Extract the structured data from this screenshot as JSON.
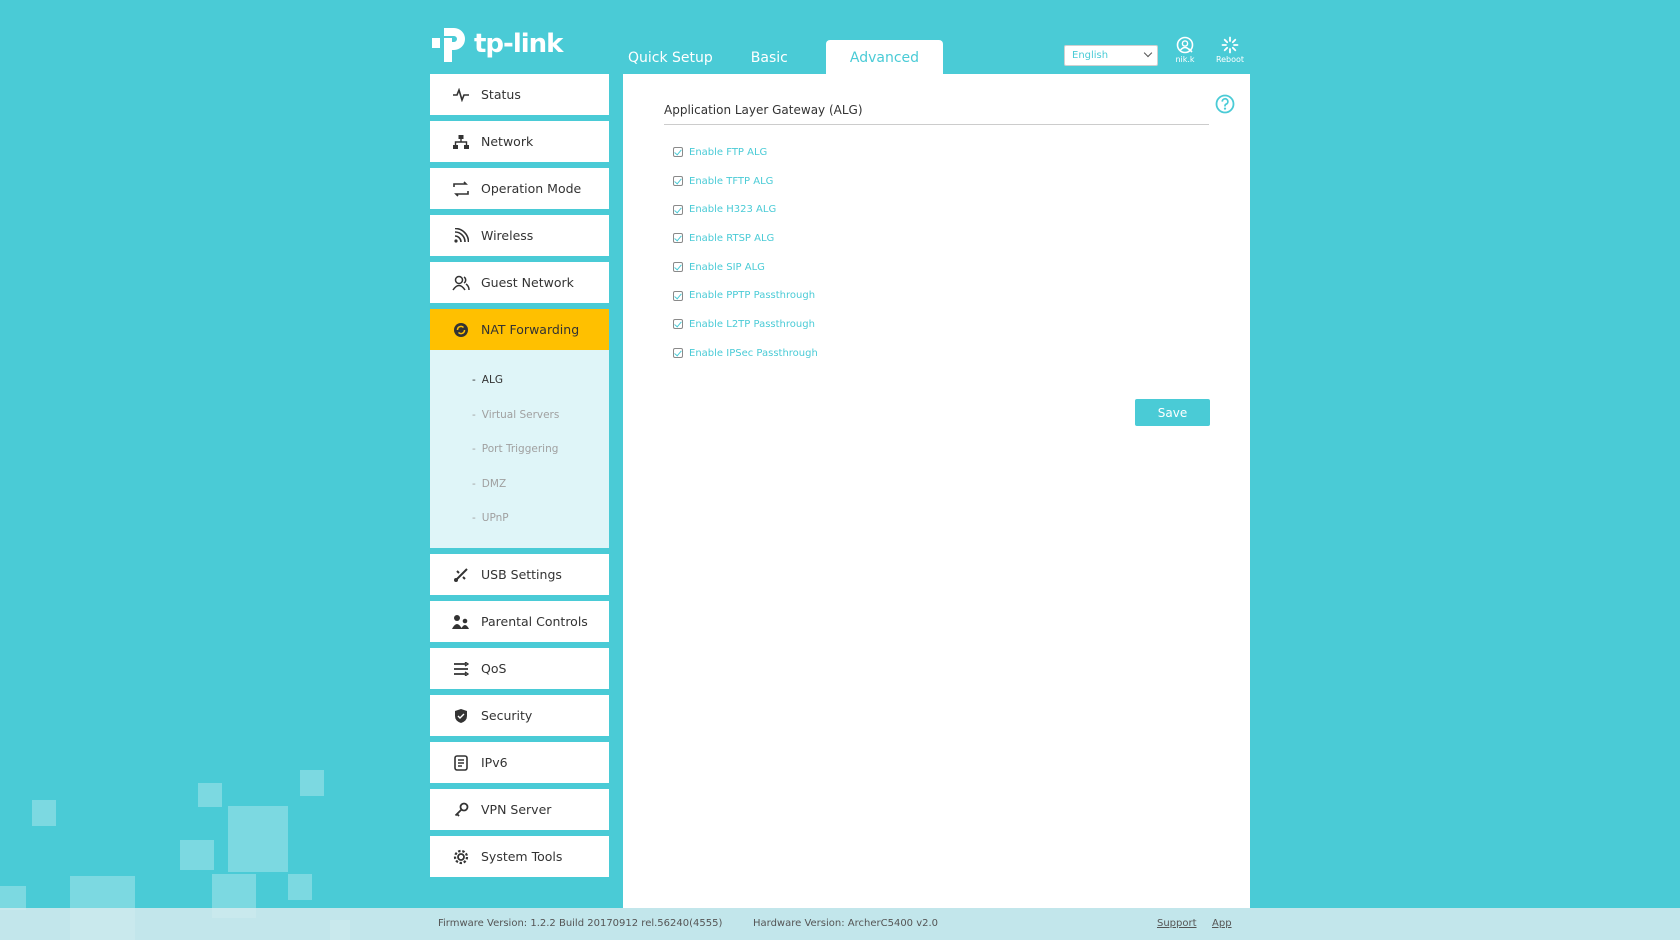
{
  "brand": {
    "logo_text": "tp-link"
  },
  "header": {
    "tabs": [
      {
        "label": "Quick Setup"
      },
      {
        "label": "Basic"
      },
      {
        "label": "Advanced",
        "active": true
      }
    ],
    "language": "English",
    "user_label": "nik.k",
    "reboot_label": "Reboot"
  },
  "sidebar": {
    "items": [
      {
        "label": "Status",
        "icon": "pulse-icon"
      },
      {
        "label": "Network",
        "icon": "network-icon"
      },
      {
        "label": "Operation Mode",
        "icon": "operation-mode-icon"
      },
      {
        "label": "Wireless",
        "icon": "wireless-icon"
      },
      {
        "label": "Guest Network",
        "icon": "guest-icon"
      },
      {
        "label": "NAT Forwarding",
        "icon": "nat-icon",
        "active": true
      },
      {
        "label": "USB Settings",
        "icon": "usb-icon"
      },
      {
        "label": "Parental Controls",
        "icon": "parental-icon"
      },
      {
        "label": "QoS",
        "icon": "qos-icon"
      },
      {
        "label": "Security",
        "icon": "shield-icon"
      },
      {
        "label": "IPv6",
        "icon": "ipv6-icon"
      },
      {
        "label": "VPN Server",
        "icon": "vpn-icon"
      },
      {
        "label": "System Tools",
        "icon": "gear-icon"
      }
    ],
    "submenu": [
      {
        "label": "ALG",
        "current": true
      },
      {
        "label": "Virtual Servers"
      },
      {
        "label": "Port Triggering"
      },
      {
        "label": "DMZ"
      },
      {
        "label": "UPnP"
      }
    ]
  },
  "main": {
    "title": "Application Layer Gateway (ALG)",
    "options": [
      {
        "label": "Enable FTP ALG",
        "checked": true
      },
      {
        "label": "Enable TFTP ALG",
        "checked": true
      },
      {
        "label": "Enable H323 ALG",
        "checked": true
      },
      {
        "label": "Enable RTSP ALG",
        "checked": true
      },
      {
        "label": "Enable SIP ALG",
        "checked": true
      },
      {
        "label": "Enable PPTP Passthrough",
        "checked": true
      },
      {
        "label": "Enable L2TP Passthrough",
        "checked": true
      },
      {
        "label": "Enable IPSec Passthrough",
        "checked": true
      }
    ],
    "save_label": "Save"
  },
  "footer": {
    "firmware": "Firmware Version: 1.2.2 Build 20170912 rel.56240(4555)",
    "hardware": "Hardware Version: ArcherC5400 v2.0",
    "support": "Support",
    "app": "App"
  },
  "colors": {
    "accent": "#4acbd6",
    "active_nav": "#ffc000",
    "submenu_bg": "#dff5f8"
  }
}
